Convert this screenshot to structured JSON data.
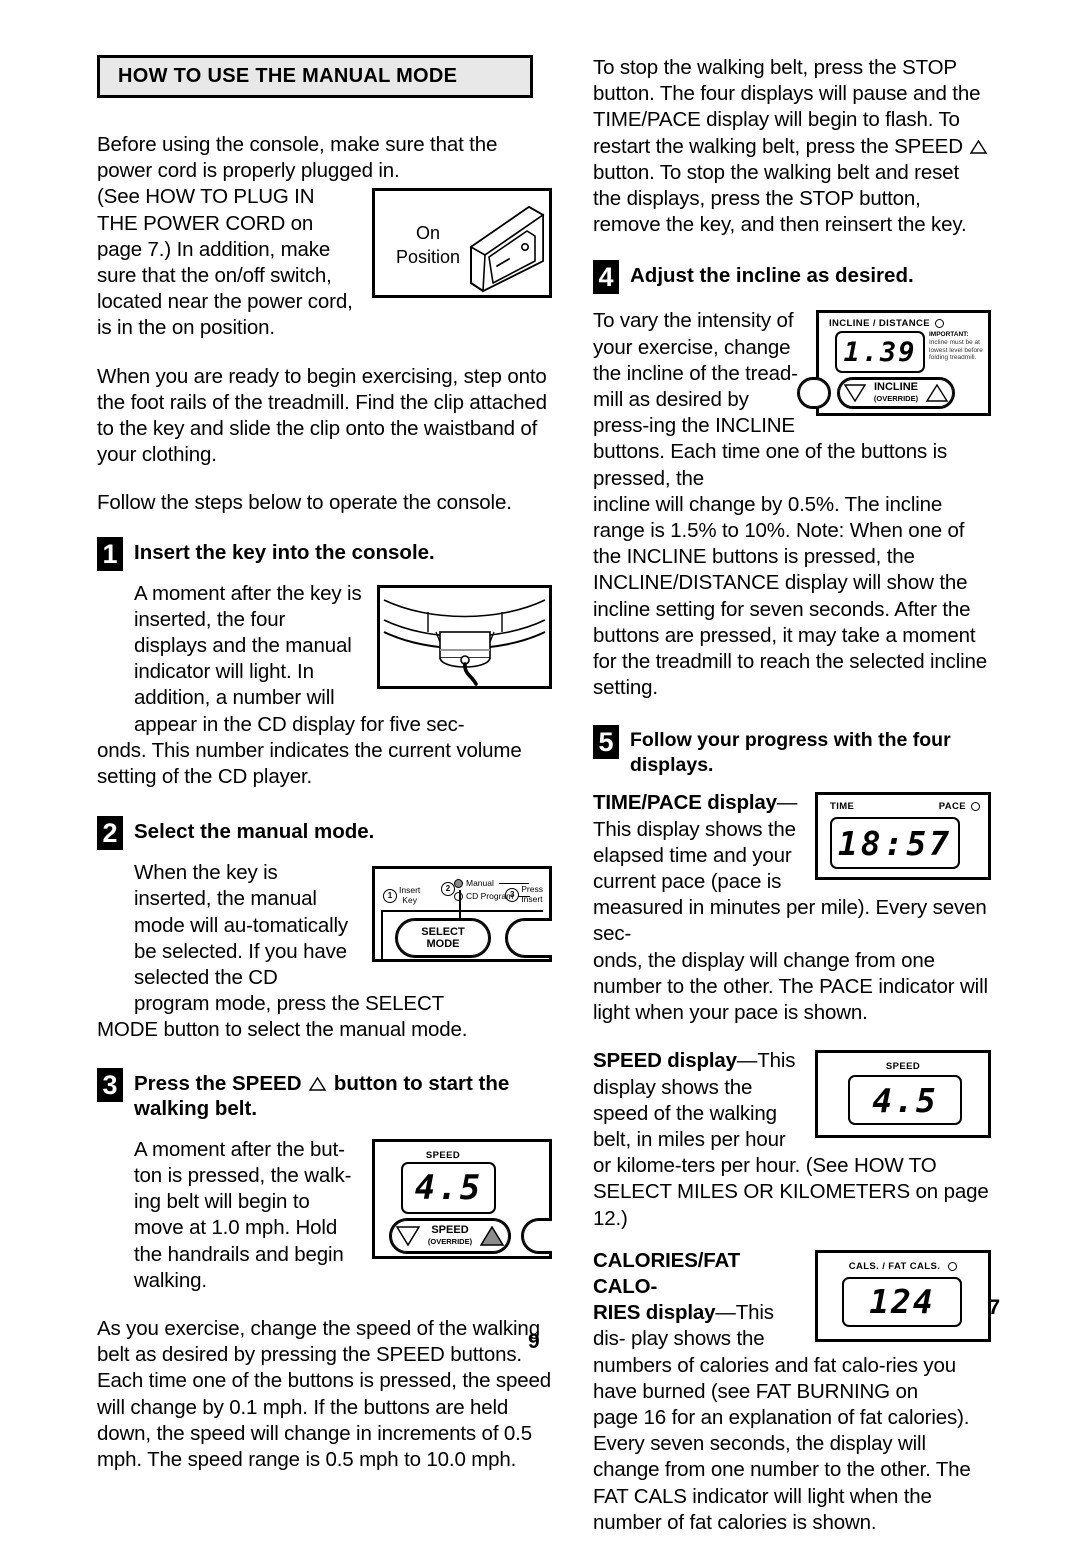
{
  "document": {
    "page_number_center": "9",
    "page_number_right": "7"
  },
  "left": {
    "section_title": "HOW TO USE THE MANUAL MODE",
    "intro1": "Before using the console, make sure that the power cord is properly plugged in.",
    "intro_wrap": "(See HOW TO PLUG IN THE POWER CORD on page 7.) In addition, make sure that the on/off switch, located near the power cord, is in the on position.",
    "intro2": "When you are ready to begin exercising, step onto the foot rails of the treadmill. Find the clip attached to the key and slide the clip onto the waistband of your clothing.",
    "intro3": "Follow the steps below to operate the console.",
    "switch_figure": {
      "label_line1": "On",
      "label_line2": "Position"
    },
    "steps": [
      {
        "number": "1",
        "title": "Insert the key into the console.",
        "body_wrap": "A moment after the key is inserted, the four displays and the manual indicator will light. In addition, a number will appear in the CD display for five sec-",
        "body_full": "onds. This number indicates the current volume setting of the CD player."
      },
      {
        "number": "2",
        "title": "Select the manual mode.",
        "body_wrap": "When the key is inserted, the manual mode will au-tomatically be selected. If you have selected the CD program mode, press the SELECT",
        "body_full": "MODE button to select the manual mode."
      },
      {
        "number": "3",
        "title_pre": "Press the SPEED",
        "title_post": "button to start the walking belt.",
        "body_wrap": "A moment after the but-ton is pressed, the walk-ing belt will begin to move at 1.0 mph. Hold the handrails and begin walking.",
        "body_full": "As you exercise, change the speed of the walking belt as desired by pressing the SPEED buttons. Each time one of the buttons is pressed, the speed will change by 0.1 mph. If the buttons are held down, the speed will change in increments of 0.5 mph. The speed range is 0.5 mph to 10.0 mph."
      }
    ],
    "select_mode_figure": {
      "marker1": "1",
      "marker1_line1": "Insert",
      "marker1_line2": "Key",
      "marker2": "2",
      "led_manual_label": "Manual",
      "led_cd_label": "CD Program",
      "marker3": "3",
      "marker3_line1": "Press",
      "marker3_line2": "Insert",
      "button_line1": "SELECT",
      "button_line2": "MODE"
    },
    "speed_figure": {
      "caption": "SPEED",
      "value": "4.5",
      "button_label": "SPEED",
      "button_sublabel": "(OVERRIDE)"
    }
  },
  "right": {
    "intro_stop": "To stop the walking belt, press the STOP button. The four displays will pause and the TIME/PACE display will begin to flash. To restart the walking belt, press the SPEED",
    "intro_stop_cont": "button. To stop the walking belt and reset the displays, press the STOP button, remove the key, and then reinsert the key.",
    "steps": [
      {
        "number": "4",
        "title": "Adjust the incline as desired.",
        "body_wrap": "To vary the intensity of your exercise, change the incline of the tread-mill as desired by press-ing the INCLINE buttons. Each time one of the buttons is pressed, the",
        "body_full": "incline will change by 0.5%. The incline range is 1.5% to 10%. Note: When one of the INCLINE buttons is pressed, the INCLINE/DISTANCE display will show the incline setting for seven seconds. After the buttons are pressed, it may take a moment for the treadmill to reach the selected incline setting."
      },
      {
        "number": "5",
        "title": "Follow your progress with the four displays."
      }
    ],
    "incline_figure": {
      "caption": "INCLINE / DISTANCE",
      "value": "1.39",
      "important_heading": "IMPORTANT:",
      "important_body": "Incline must be at lowest level before folding treadmill.",
      "button_label": "INCLINE",
      "button_sublabel": "(OVERRIDE)"
    },
    "displays": [
      {
        "heading": "TIME/PACE display",
        "dash": "—",
        "body_wrap": "This display shows the elapsed time and your current pace (pace is measured in minutes per mile). Every seven sec-",
        "body_full": "onds, the display will change from one number to the other. The PACE indicator will light when your pace is shown.",
        "figure": {
          "caption_left": "TIME",
          "caption_right": "PACE",
          "value": "18:57"
        }
      },
      {
        "heading": "SPEED display",
        "dash": "—",
        "lead": "This",
        "body_wrap": "display shows the speed of the walking belt, in miles per hour or kilome-ters per hour. (See HOW TO SELECT MILES OR KILOMETERS on page 12.)",
        "figure": {
          "caption": "SPEED",
          "value": "4.5"
        }
      },
      {
        "heading_line1": "CALORIES/FAT CALO-",
        "heading_line2": "RIES display",
        "dash": "—",
        "lead": "This dis-",
        "body_wrap": "play shows the numbers of calories and fat calo-ries you have burned (see FAT BURNING on",
        "body_full": "page 16 for an explanation of fat calories). Every seven seconds, the display will change from one number to the other. The FAT CALS indicator will light when the number of fat calories is shown.",
        "figure": {
          "caption": "CALS. / FAT CALS.",
          "value": "124"
        }
      }
    ]
  }
}
